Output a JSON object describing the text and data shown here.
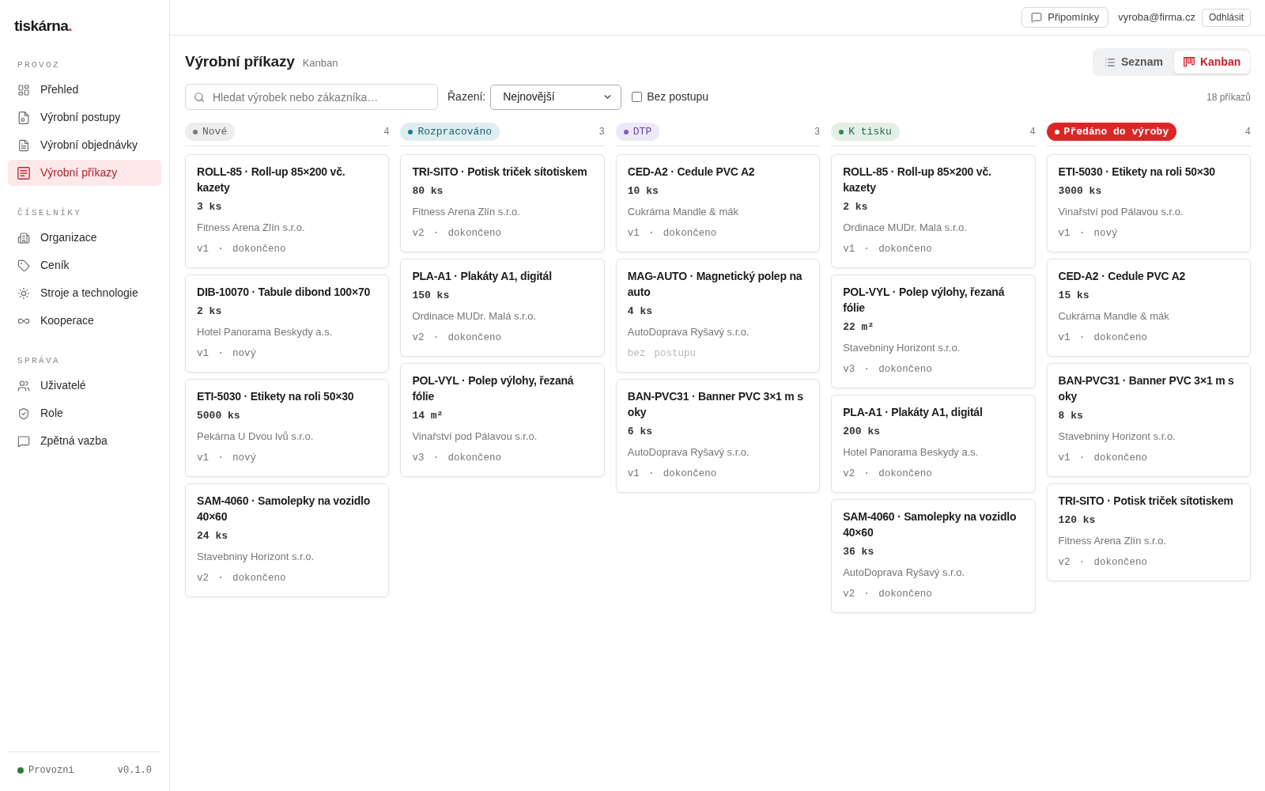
{
  "sidebar": {
    "logo": {
      "text": "tiskárna",
      "accent": "."
    },
    "sections": [
      {
        "title": "PROVOZ",
        "items": [
          {
            "label": "Přehled",
            "selected": false
          },
          {
            "label": "Výrobní postupy",
            "selected": false
          },
          {
            "label": "Výrobní objednávky",
            "selected": false
          },
          {
            "label": "Výrobní příkazy",
            "selected": true
          }
        ]
      },
      {
        "title": "ČÍSELNÍKY",
        "items": [
          {
            "label": "Organizace",
            "selected": false
          },
          {
            "label": "Ceník",
            "selected": false
          },
          {
            "label": "Stroje a technologie",
            "selected": false
          },
          {
            "label": "Kooperace",
            "selected": false
          }
        ]
      },
      {
        "title": "SPRÁVA",
        "items": [
          {
            "label": "Uživatelé",
            "selected": false
          },
          {
            "label": "Role",
            "selected": false
          },
          {
            "label": "Zpětná vazba",
            "selected": false
          }
        ]
      }
    ],
    "footer": {
      "status": "Provozni",
      "color": "#2e7d32",
      "version": "v0.1.0"
    }
  },
  "top_bar": {
    "feedback_button": "Připomínky",
    "user_email": "vyroba@firma.cz",
    "logout_button": "Odhlásit"
  },
  "header": {
    "title": "Výrobní příkazy",
    "subtitle": "Kanban",
    "view_toggle": [
      {
        "label": "Seznam",
        "selected": false
      },
      {
        "label": "Kanban",
        "selected": true
      }
    ]
  },
  "filters": {
    "search": {
      "placeholder": "Hledat výrobek nebo zákazníka…"
    },
    "sort": {
      "label": "Řazení:",
      "value": "Nejnovější"
    },
    "no_routing": {
      "label": "Bez postupu",
      "checked": false
    },
    "total": "18 příkazů"
  },
  "columns": [
    {
      "title": "Nové",
      "count": "4",
      "color": "#7b7b7b",
      "kind": "soft",
      "cards": [
        {
          "title": "ROLL-85 · Roll-up 85×200 vč. kazety",
          "quantity": "3 ks",
          "customer": "Fitness Arena Zlín s.r.o.",
          "meta": "v1 · dokončeno",
          "routing": true
        },
        {
          "title": "DIB-10070 · Tabule dibond 100×70",
          "quantity": "2 ks",
          "customer": "Hotel Panorama Beskydy a.s.",
          "meta": "v1 · nový",
          "routing": true
        },
        {
          "title": "ETI-5030 · Etikety na roli 50×30",
          "quantity": "5000 ks",
          "customer": "Pekárna U Dvou lvů s.r.o.",
          "meta": "v1 · nový",
          "routing": true
        },
        {
          "title": "SAM-4060 · Samolepky na vozidlo 40×60",
          "quantity": "24 ks",
          "customer": "Stavebniny Horizont s.r.o.",
          "meta": "v2 · dokončeno",
          "routing": true
        }
      ]
    },
    {
      "title": "Rozpracováno",
      "count": "3",
      "color": "#1c7d96",
      "kind": "soft",
      "cards": [
        {
          "title": "TRI-SITO · Potisk triček sítotiskem",
          "quantity": "80 ks",
          "customer": "Fitness Arena Zlín s.r.o.",
          "meta": "v2 · dokončeno",
          "routing": true
        },
        {
          "title": "PLA-A1 · Plakáty A1, digitál",
          "quantity": "150 ks",
          "customer": "Ordinace MUDr. Malá s.r.o.",
          "meta": "v2 · dokončeno",
          "routing": true
        },
        {
          "title": "POL-VYL · Polep výlohy, řezaná fólie",
          "quantity": "14 m²",
          "customer": "Vinařství pod Pálavou s.r.o.",
          "meta": "v3 · dokončeno",
          "routing": true
        }
      ]
    },
    {
      "title": "DTP",
      "count": "3",
      "color": "#7e5cc8",
      "kind": "soft",
      "cards": [
        {
          "title": "CED-A2 · Cedule PVC A2",
          "quantity": "10 ks",
          "customer": "Cukrárna Mandle & mák",
          "meta": "v1 · dokončeno",
          "routing": true
        },
        {
          "title": "MAG-AUTO · Magnetický polep na auto",
          "quantity": "4 ks",
          "customer": "AutoDoprava Ryšavý s.r.o.",
          "meta": "bez postupu",
          "routing": false
        },
        {
          "title": "BAN-PVC31 · Banner PVC 3×1 m s oky",
          "quantity": "6 ks",
          "customer": "AutoDoprava Ryšavý s.r.o.",
          "meta": "v1 · dokončeno",
          "routing": true
        }
      ]
    },
    {
      "title": "K tisku",
      "count": "4",
      "color": "#2f8a50",
      "kind": "soft",
      "cards": [
        {
          "title": "ROLL-85 · Roll-up 85×200 vč. kazety",
          "quantity": "2 ks",
          "customer": "Ordinace MUDr. Malá s.r.o.",
          "meta": "v1 · dokončeno",
          "routing": true
        },
        {
          "title": "POL-VYL · Polep výlohy, řezaná fólie",
          "quantity": "22 m²",
          "customer": "Stavebniny Horizont s.r.o.",
          "meta": "v3 · dokončeno",
          "routing": true
        },
        {
          "title": "PLA-A1 · Plakáty A1, digitál",
          "quantity": "200 ks",
          "customer": "Hotel Panorama Beskydy a.s.",
          "meta": "v2 · dokončeno",
          "routing": true
        },
        {
          "title": "SAM-4060 · Samolepky na vozidlo 40×60",
          "quantity": "36 ks",
          "customer": "AutoDoprava Ryšavý s.r.o.",
          "meta": "v2 · dokončeno",
          "routing": true
        }
      ]
    },
    {
      "title": "Předáno do výroby",
      "count": "4",
      "color": "#dc2626",
      "kind": "solid",
      "cards": [
        {
          "title": "ETI-5030 · Etikety na roli 50×30",
          "quantity": "3000 ks",
          "customer": "Vinařství pod Pálavou s.r.o.",
          "meta": "v1 · nový",
          "routing": true
        },
        {
          "title": "CED-A2 · Cedule PVC A2",
          "quantity": "15 ks",
          "customer": "Cukrárna Mandle & mák",
          "meta": "v1 · dokončeno",
          "routing": true
        },
        {
          "title": "BAN-PVC31 · Banner PVC 3×1 m s oky",
          "quantity": "8 ks",
          "customer": "Stavebniny Horizont s.r.o.",
          "meta": "v1 · dokončeno",
          "routing": true
        },
        {
          "title": "TRI-SITO · Potisk triček sítotiskem",
          "quantity": "120 ks",
          "customer": "Fitness Arena Zlín s.r.o.",
          "meta": "v2 · dokončeno",
          "routing": true
        }
      ]
    }
  ]
}
